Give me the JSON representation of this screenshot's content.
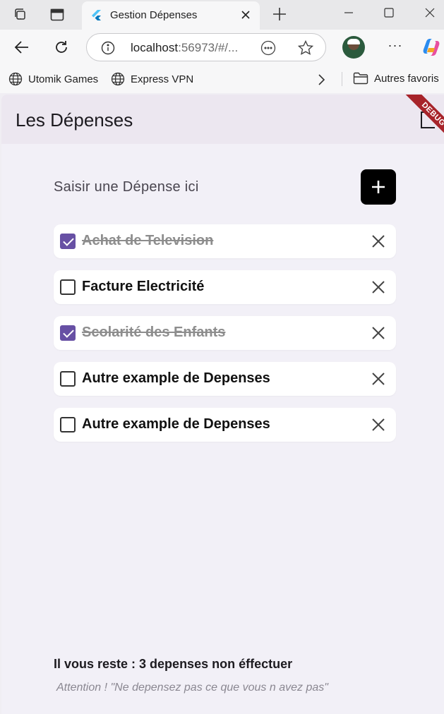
{
  "browser": {
    "tab_title": "Gestion Dépenses",
    "url_host": "localhost",
    "url_rest": ":56973/#/...",
    "favorites": [
      {
        "label": "Utomik Games",
        "icon": "globe-icon"
      },
      {
        "label": "Express VPN",
        "icon": "globe-icon"
      },
      {
        "label": "Autres favoris",
        "icon": "folder-icon"
      }
    ],
    "colors": {
      "chrome": "#f7f7f8",
      "tabbar": "#e8e8ea"
    }
  },
  "app": {
    "title": "Les Dépenses",
    "debug_banner": "DEBUG",
    "input_label": "Saisir une Dépense ici",
    "add_icon": "plus-icon",
    "items": [
      {
        "label": "Achat de Television",
        "checked": true
      },
      {
        "label": "Facture Electricité",
        "checked": false
      },
      {
        "label": "Scolarité des Enfants",
        "checked": true
      },
      {
        "label": "Autre example  de Depenses",
        "checked": false
      },
      {
        "label": "Autre example  de Depenses",
        "checked": false
      }
    ],
    "footer_count": "Il vous reste : 3 depenses non éffectuer",
    "footer_quote": "Attention ! \"Ne depensez pas ce que vous n avez pas\"",
    "colors": {
      "checkbox_checked": "#6750a4",
      "appbar": "#ece7f0",
      "background": "#f2f0f7",
      "debug": "#a7242a"
    }
  }
}
